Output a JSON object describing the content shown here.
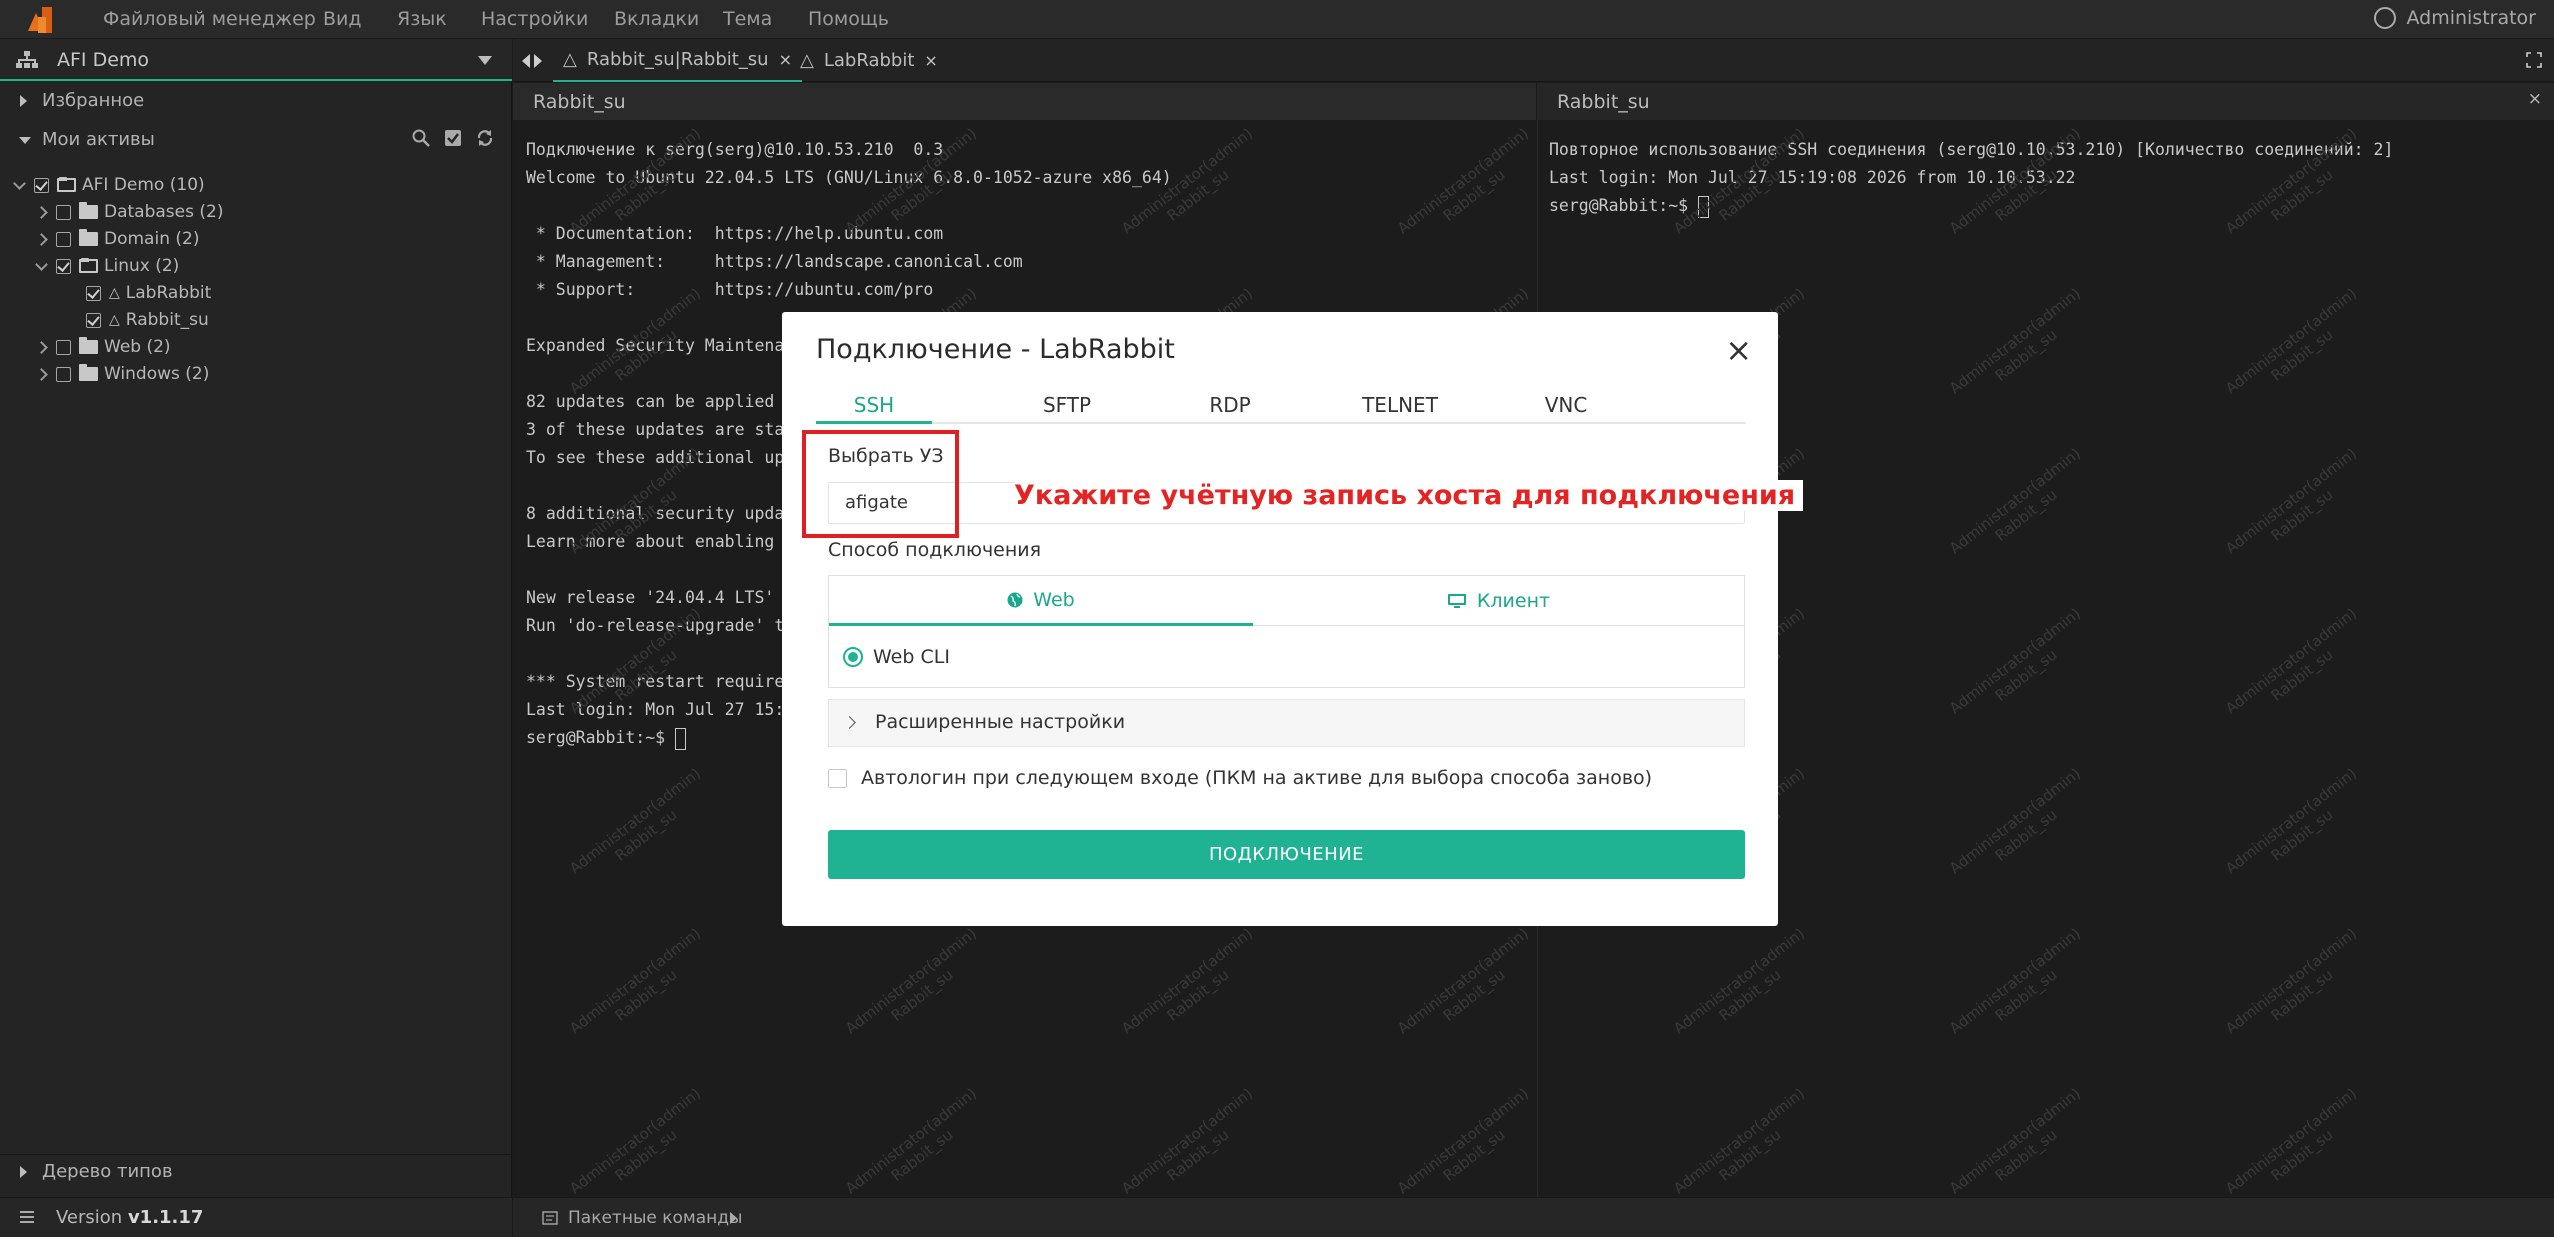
{
  "menu": [
    "Файловый менеджер",
    "Вид",
    "Язык",
    "Настройки",
    "Вкладки",
    "Тема",
    "Помощь"
  ],
  "user": "Administrator",
  "workspace": "AFI Demo",
  "sidebar": {
    "favorites": "Избранное",
    "my_assets": "Мои активы",
    "tree": [
      {
        "label": "AFI Demo (10)"
      },
      {
        "label": "Databases (2)"
      },
      {
        "label": "Domain (2)"
      },
      {
        "label": "Linux (2)"
      },
      {
        "label": "LabRabbit"
      },
      {
        "label": "Rabbit_su"
      },
      {
        "label": "Web (2)"
      },
      {
        "label": "Windows (2)"
      }
    ],
    "type_tree": "Дерево типов",
    "version_label": "Version",
    "version": "v1.1.17"
  },
  "tabs": [
    {
      "label": "Rabbit_su|Rabbit_su",
      "close": "×"
    },
    {
      "label": "LabRabbit",
      "close": "×"
    }
  ],
  "panes": {
    "left_title": "Rabbit_su",
    "right_title": "Rabbit_su",
    "right_close": "×"
  },
  "terminal_left": [
    "Подключение к serg(serg)@10.10.53.210  0.3",
    "Welcome to Ubuntu 22.04.5 LTS (GNU/Linux 6.8.0-1052-azure x86_64)",
    "",
    " * Documentation:  https://help.ubuntu.com",
    " * Management:     https://landscape.canonical.com",
    " * Support:        https://ubuntu.com/pro",
    "",
    "Expanded Security Maintena",
    "",
    "82 updates can be applied",
    "3 of these updates are sta",
    "To see these additional up",
    "",
    "8 additional security upda",
    "Learn more about enabling",
    "",
    "New release '24.04.4 LTS'",
    "Run 'do-release-upgrade' t",
    "",
    "*** System restart require",
    "Last login: Mon Jul 27 15:",
    "serg@Rabbit:~$ "
  ],
  "terminal_right": [
    "Повторное использование SSH соединения (serg@10.10.53.210) [Количество соединений: 2]",
    "Last login: Mon Jul 27 15:19:08 2026 from 10.10.53.22",
    "serg@Rabbit:~$ "
  ],
  "watermark": {
    "line1": "Administrator(admin)",
    "line2": "Rabbit_su"
  },
  "status": {
    "batch_commands": "Пакетные команды"
  },
  "modal": {
    "title": "Подключение - LabRabbit",
    "close": "×",
    "tabs": [
      "SSH",
      "SFTP",
      "RDP",
      "TELNET",
      "VNC"
    ],
    "account_label": "Выбрать УЗ",
    "account_value": "afigate",
    "callout": "Укажите учётную запись хоста для подключения",
    "method_label": "Способ подключения",
    "method_web": "Web",
    "method_client": "Клиент",
    "web_cli": "Web CLI",
    "advanced": "Расширенные настройки",
    "autologin": "Автологин при следующем входе (ПКМ на активе для выбора способа заново)",
    "connect": "ПОДКЛЮЧЕНИЕ"
  },
  "colors": {
    "accent": "#1fb394",
    "callout": "#e42323",
    "brand_logo": "#e8701a"
  }
}
